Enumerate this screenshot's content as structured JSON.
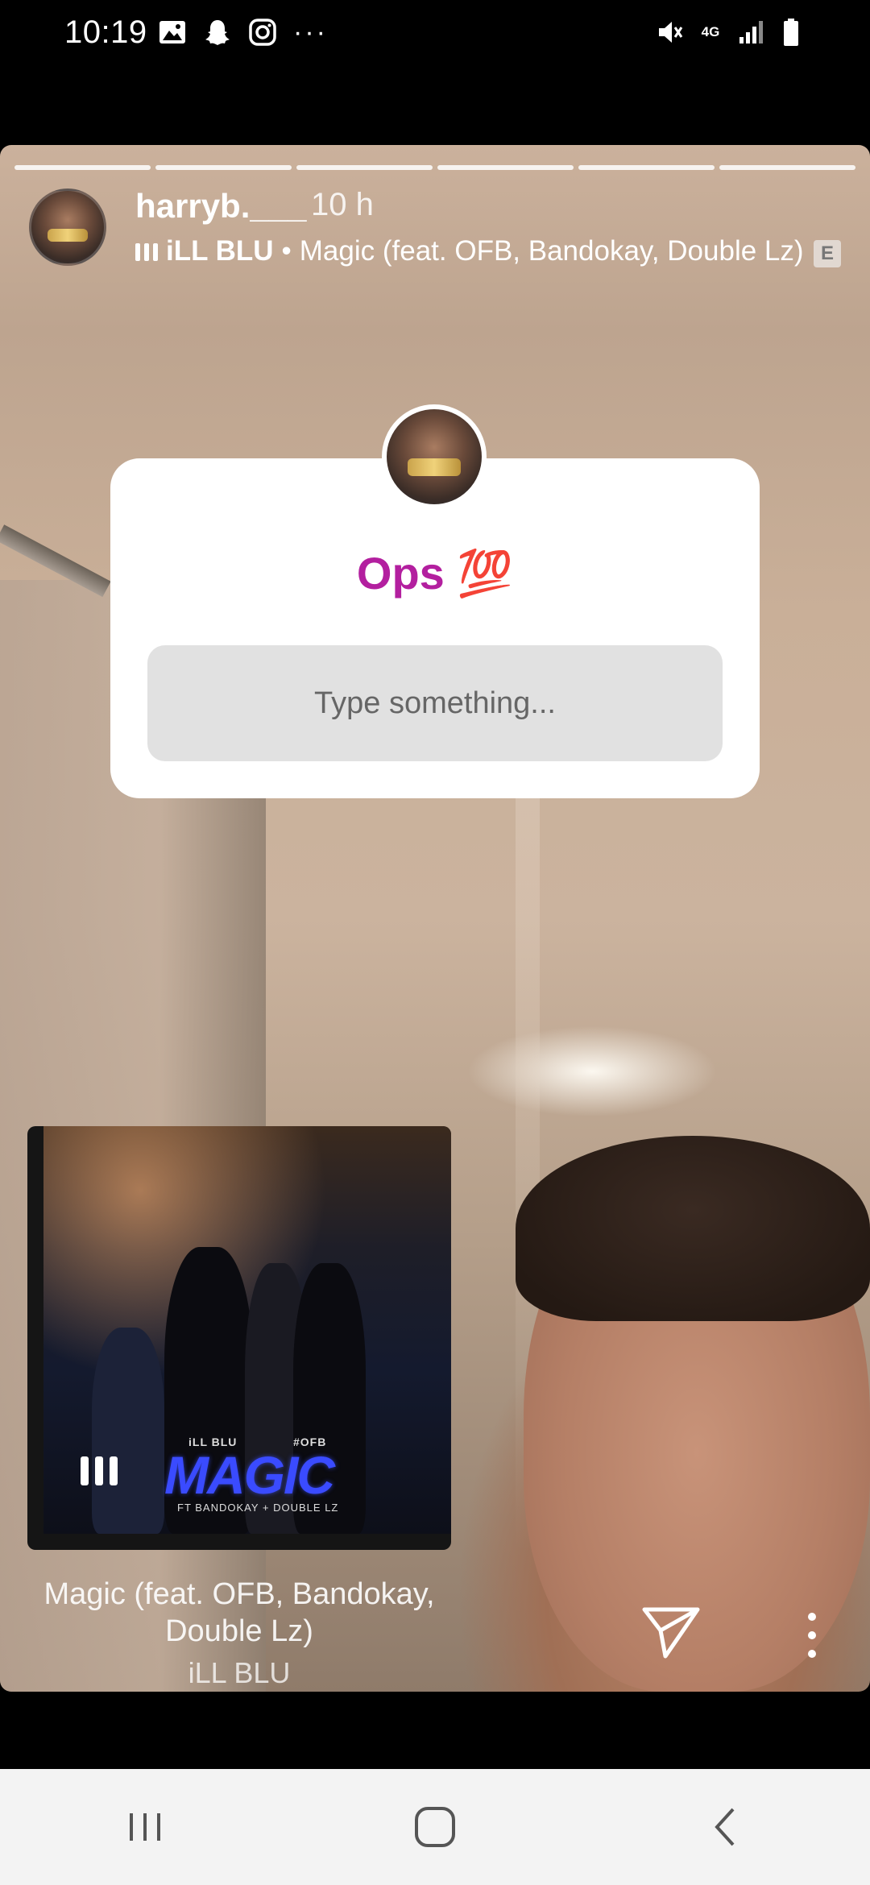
{
  "status_bar": {
    "time": "10:19",
    "left_icons": [
      "gallery-icon",
      "snapchat-icon",
      "instagram-icon",
      "more-icon"
    ],
    "more": "···",
    "network": "4G",
    "right_icons": [
      "mute-icon",
      "4g-icon",
      "signal-icon",
      "battery-icon"
    ]
  },
  "story": {
    "progress_segments": 6,
    "username": "harryb.___",
    "time_ago": "10 h",
    "music": {
      "artist": "iLL BLU",
      "separator": "•",
      "track": "Magic (feat. OFB, Bandokay, Double Lz)",
      "explicit_badge": "E"
    },
    "question_sticker": {
      "title": "Ops 💯",
      "placeholder": "Type something..."
    },
    "music_sticker": {
      "art_artist": "iLL BLU",
      "art_tag": "#OFB",
      "art_title": "MAGIC",
      "art_feat": "FT BANDOKAY + DOUBLE LZ",
      "song_title": "Magic (feat. OFB, Bandokay, Double Lz)",
      "song_artist": "iLL BLU"
    },
    "actions": [
      "send-icon",
      "more-options-icon"
    ]
  },
  "nav_bar": {
    "buttons": [
      "recent-apps-icon",
      "home-icon",
      "back-icon"
    ]
  },
  "colors": {
    "question_title": "#b31f9f",
    "input_bg": "#e1e1e1",
    "navbar_bg": "#f3f3f3"
  }
}
